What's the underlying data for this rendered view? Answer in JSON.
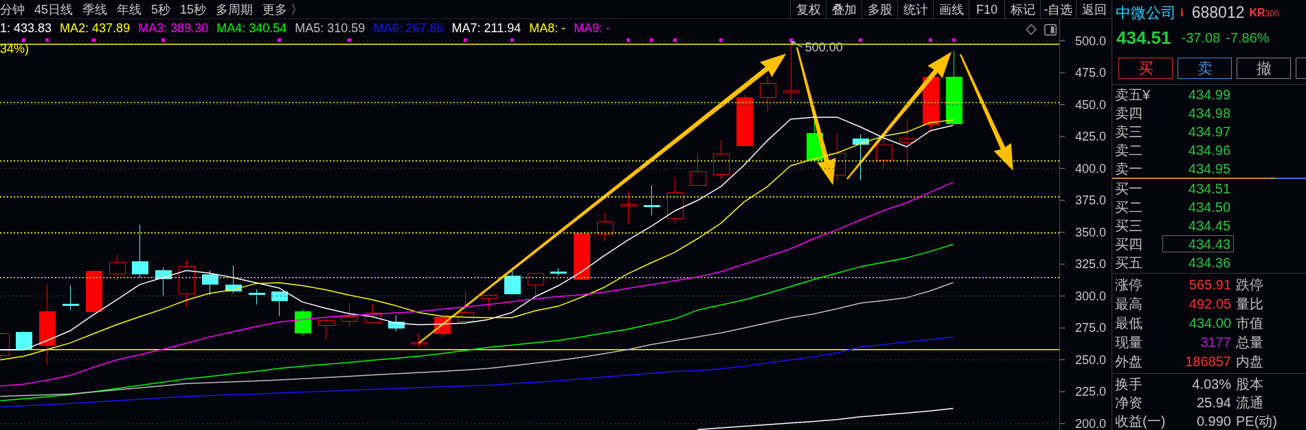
{
  "toolbar": {
    "period_tabs": [
      "分钟",
      "45日线",
      "季线",
      "年线",
      "5秒",
      "15秒",
      "多周期",
      "更多 〉"
    ],
    "tools": [
      "复权",
      "叠加",
      "多股",
      "统计",
      "画线",
      "F10",
      "标记",
      "-自选",
      "返回"
    ]
  },
  "chart": {
    "ma_legend": [
      {
        "text": "1: 433.83",
        "color": "#ffffff"
      },
      {
        "text": "MA2: 437.89",
        "color": "#ffff00"
      },
      {
        "text": "MA3: 389.30",
        "color": "#ff00ff"
      },
      {
        "text": "MA4: 340.54",
        "color": "#00ff00"
      },
      {
        "text": "MA5: 310.59",
        "color": "#c0c0c0"
      },
      {
        "text": "MA6: 267.86",
        "color": "#1515ff"
      },
      {
        "text": "MA7: 211.94",
        "color": "#ffffff"
      },
      {
        "text": "MA8: -",
        "color": "#ffff00"
      },
      {
        "text": "MA9: -",
        "color": "#ff00ff"
      }
    ],
    "note": "34%)",
    "chart_data": {
      "type": "line",
      "ylim": [
        195,
        517
      ],
      "grid": true,
      "yticks": [
        {
          "value": 500,
          "label": "500.0"
        },
        {
          "value": 475,
          "label": "475.0"
        },
        {
          "value": 450,
          "label": "450.0"
        },
        {
          "value": 425,
          "label": "425.0"
        },
        {
          "value": 400,
          "label": "400.0"
        },
        {
          "value": 375,
          "label": "375.0"
        },
        {
          "value": 350,
          "label": "350.0"
        },
        {
          "value": 325,
          "label": "325.0"
        },
        {
          "value": 300,
          "label": "300.0"
        },
        {
          "value": 275,
          "label": "275.0"
        },
        {
          "value": 250,
          "label": "250.0"
        },
        {
          "value": 225,
          "label": "225.0"
        },
        {
          "value": 200,
          "label": "200.0"
        }
      ],
      "series": [
        {
          "color": "#ffffff",
          "values": [
            257.8,
            257.8,
            265,
            272.8,
            285.2,
            297,
            309,
            314.5,
            320,
            318,
            314.5,
            310.4,
            306.2,
            295.3,
            290.4,
            286.2,
            283.8,
            278.9,
            277.5,
            278,
            278.9,
            281.6,
            287.1,
            299.4,
            308,
            319,
            331.9,
            343.8,
            354.6,
            366.6,
            375,
            385.8,
            402.6,
            421.8,
            438.6,
            440.2,
            440.2,
            432.6,
            424,
            417,
            429.5,
            433.8
          ]
        },
        {
          "color": "#ffff00",
          "values": [
            250,
            252.8,
            258,
            263.2,
            270.4,
            277.5,
            283.8,
            289.8,
            296.7,
            302.1,
            304.9,
            309.8,
            310.4,
            308.2,
            304.9,
            300.8,
            297.2,
            292.5,
            287.1,
            284.3,
            283.5,
            283,
            283,
            288.4,
            292,
            299,
            307,
            317.5,
            326,
            334.2,
            345,
            357,
            373.8,
            385.8,
            402.1,
            407.4,
            412.2,
            419.4,
            425.4,
            428.5,
            436,
            437.9
          ]
        },
        {
          "color": "#ff00ff",
          "values": [
            229.5,
            230.9,
            234,
            237.8,
            244,
            250,
            254,
            258.3,
            263,
            267.9,
            272,
            276,
            279.7,
            281.6,
            283.5,
            284.6,
            285.7,
            286.8,
            287.9,
            289.7,
            291.5,
            293.4,
            295.6,
            297.8,
            299.5,
            301,
            303,
            306,
            309,
            312,
            315,
            319,
            325,
            331,
            337,
            345,
            352,
            359.6,
            367,
            373.2,
            381.3,
            389.3
          ]
        },
        {
          "color": "#00ff00",
          "values": [
            218,
            219.5,
            221,
            222.7,
            225,
            227.5,
            230,
            232.5,
            235,
            237,
            239,
            241,
            243.2,
            245,
            246.5,
            248,
            249.7,
            251.2,
            252.8,
            255,
            257.4,
            259.7,
            261.5,
            263.4,
            265.2,
            268,
            271,
            274,
            278,
            282,
            289,
            293,
            297,
            302,
            307.5,
            313,
            318,
            323,
            326.5,
            330,
            335,
            340.5
          ]
        },
        {
          "color": "#c0c0c0",
          "values": [
            221.3,
            222,
            222.6,
            223.2,
            224.8,
            226.4,
            228,
            229.7,
            231.4,
            232.1,
            232.8,
            233.5,
            234.2,
            235.2,
            236.1,
            237.1,
            238.1,
            239,
            240,
            241,
            242.1,
            243.2,
            245.3,
            247.4,
            249.5,
            252,
            255,
            258,
            262,
            265,
            268,
            271,
            275,
            279,
            283,
            286,
            290,
            294.4,
            296.5,
            298.8,
            304,
            310.6
          ]
        },
        {
          "color": "#1515ff",
          "values": [
            213,
            213.9,
            214.9,
            215.8,
            216.9,
            218,
            219.1,
            220.2,
            221.3,
            222,
            222.7,
            223.3,
            224,
            224.7,
            225.4,
            226.1,
            226.8,
            227.5,
            228.2,
            228.8,
            229.5,
            230.1,
            231.3,
            232.4,
            233.6,
            235,
            236.5,
            238,
            239.5,
            241,
            241.5,
            243,
            245,
            247.5,
            250,
            252.5,
            255.5,
            260,
            262,
            264,
            266,
            267.9
          ]
        },
        {
          "color": "#ffffff",
          "values": [
            null,
            null,
            null,
            null,
            null,
            null,
            null,
            null,
            null,
            null,
            null,
            null,
            null,
            null,
            null,
            null,
            null,
            null,
            null,
            null,
            null,
            null,
            null,
            null,
            null,
            null,
            null,
            null,
            null,
            null,
            195.3,
            196.6,
            197.9,
            199.2,
            200.5,
            201.8,
            203.2,
            205.3,
            206.8,
            208.3,
            209.9,
            211.9
          ]
        }
      ],
      "ref_lines": [
        {
          "axis": "y",
          "value": 497.4
        },
        {
          "axis": "y",
          "value": 451.7
        },
        {
          "axis": "y",
          "value": 405.9
        },
        {
          "axis": "y",
          "value": 377.7
        },
        {
          "axis": "y",
          "value": 349.5
        },
        {
          "axis": "y",
          "value": 314.5
        },
        {
          "axis": "y",
          "value": 258
        }
      ],
      "annotations": [
        "500.00"
      ]
    },
    "candles": [
      {
        "color": "#ff0000",
        "filled": false
      },
      {
        "color": "#54fcfc",
        "filled": true
      },
      {
        "color": "#ff0000",
        "filled": true
      },
      {
        "color": "#54fcfc",
        "filled": true
      },
      {
        "color": "#ff0000",
        "filled": true
      },
      {
        "color": "#ff0000",
        "filled": false
      },
      {
        "color": "#54fcfc",
        "filled": true
      },
      {
        "color": "#54fcfc",
        "filled": true
      },
      {
        "color": "#ff0000",
        "filled": false
      },
      {
        "color": "#54fcfc",
        "filled": true
      },
      {
        "color": "#54fcfc",
        "filled": true
      },
      {
        "color": "#54fcfc",
        "filled": true
      },
      {
        "color": "#54fcfc",
        "filled": true
      },
      {
        "color": "#00ff00",
        "filled": true
      },
      {
        "color": "#ff0000",
        "filled": false
      },
      {
        "color": "#ff0000",
        "filled": false
      },
      {
        "color": "#ff0000",
        "filled": false
      },
      {
        "color": "#54fcfc",
        "filled": true
      },
      {
        "color": "#ff0000",
        "filled": false
      },
      {
        "color": "#ff0000",
        "filled": true
      },
      {
        "color": "#ff0000",
        "filled": false
      },
      {
        "color": "#ff0000",
        "filled": false
      },
      {
        "color": "#54fcfc",
        "filled": true
      },
      {
        "color": "#ff0000",
        "filled": false
      },
      {
        "color": "#54fcfc",
        "filled": true
      },
      {
        "color": "#ff0000",
        "filled": true
      },
      {
        "color": "#ff0000",
        "filled": false
      },
      {
        "color": "#ff0000",
        "filled": false
      },
      {
        "color": "#54fcfc",
        "filled": true
      },
      {
        "color": "#ff0000",
        "filled": false
      },
      {
        "color": "#ff0000",
        "filled": false
      },
      {
        "color": "#ff0000",
        "filled": false
      },
      {
        "color": "#ff0000",
        "filled": true
      },
      {
        "color": "#ff0000",
        "filled": false
      },
      {
        "color": "#ff0000",
        "filled": false
      },
      {
        "color": "#00ff00",
        "filled": true
      },
      {
        "color": "#ff0000",
        "filled": false
      },
      {
        "color": "#54fcfc",
        "filled": true
      },
      {
        "color": "#ff0000",
        "filled": false
      },
      {
        "color": "#ff0000",
        "filled": false
      },
      {
        "color": "#ff0000",
        "filled": true
      },
      {
        "color": "#00ff00",
        "filled": true
      }
    ]
  },
  "quote_panel": {
    "name": "中微公司",
    "info_mark": "i",
    "code": "688012",
    "market_tag": {
      "main": "KR",
      "suffix": "300"
    },
    "price": "434.51",
    "change": "-37.08",
    "change_pct": "-7.86%",
    "actions": [
      {
        "label": "买",
        "kind": "buy"
      },
      {
        "label": "卖",
        "kind": "sell"
      },
      {
        "label": "撤",
        "kind": "cancel"
      }
    ],
    "asks": [
      {
        "label": "卖五¥",
        "price": "434.99",
        "selected": false
      },
      {
        "label": "卖四",
        "price": "434.98",
        "selected": false
      },
      {
        "label": "卖三",
        "price": "434.97",
        "selected": false
      },
      {
        "label": "卖二",
        "price": "434.96",
        "selected": false
      },
      {
        "label": "卖一",
        "price": "434.95",
        "selected": false
      }
    ],
    "bids": [
      {
        "label": "买一",
        "price": "434.51",
        "selected": false
      },
      {
        "label": "买二",
        "price": "434.50",
        "selected": false
      },
      {
        "label": "买三",
        "price": "434.45",
        "selected": false
      },
      {
        "label": "买四",
        "price": "434.43",
        "selected": true
      },
      {
        "label": "买五",
        "price": "434.36",
        "selected": false
      }
    ],
    "stats": [
      {
        "label": "涨停",
        "value": "565.91",
        "color": "#ff3030",
        "label_2": "跌停"
      },
      {
        "label": "最高",
        "value": "492.05",
        "color": "#ff3030",
        "label_2": "量比"
      },
      {
        "label": "最低",
        "value": "434.00",
        "color": "#25c93a",
        "label_2": "市值"
      },
      {
        "label": "现量",
        "value": "3177",
        "color": "#b41ed2",
        "label_2": "总量"
      },
      {
        "label": "外盘",
        "value": "186857",
        "color": "#ff3030",
        "label_2": "内盘"
      }
    ],
    "fundamentals": [
      {
        "label": "换手",
        "value": "4.03%",
        "label_2": "股本"
      },
      {
        "label": "净资",
        "value": "25.94",
        "label_2": "流通"
      },
      {
        "label": "收益(一)",
        "value": "0.990",
        "label_2": "PE(动)"
      }
    ]
  }
}
